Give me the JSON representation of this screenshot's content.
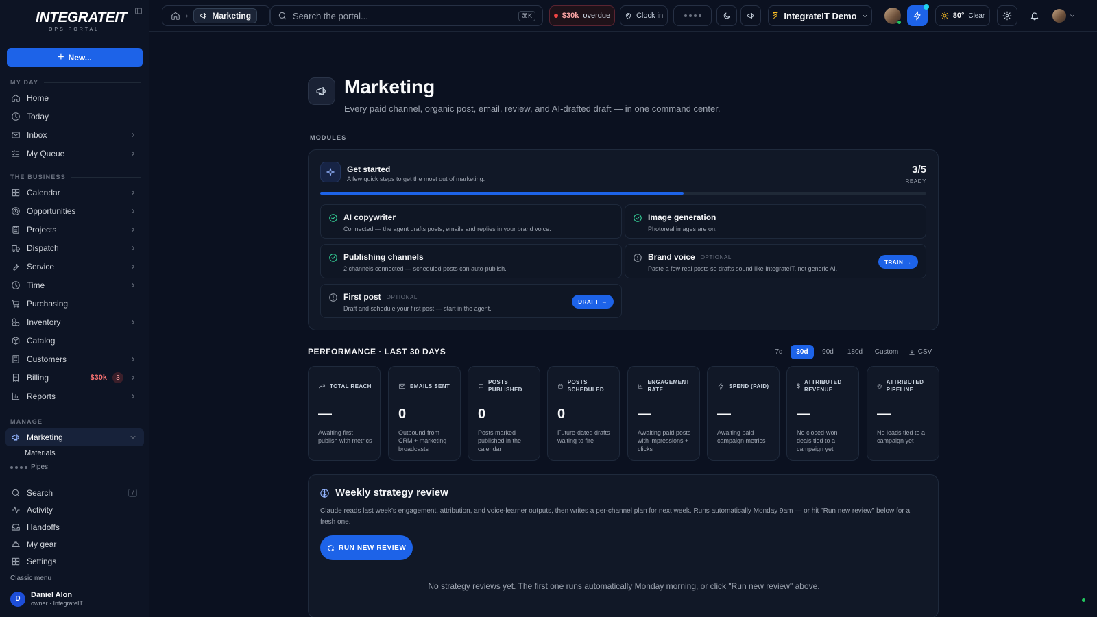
{
  "sidebar": {
    "logo": "INTEGRATEIT",
    "logo_sub": "OPS PORTAL",
    "new_label": "New...",
    "sections": {
      "my_day": "MY DAY",
      "business": "THE BUSINESS",
      "manage": "MANAGE"
    },
    "items": {
      "home": "Home",
      "today": "Today",
      "inbox": "Inbox",
      "queue": "My Queue",
      "calendar": "Calendar",
      "opportunities": "Opportunities",
      "projects": "Projects",
      "dispatch": "Dispatch",
      "service": "Service",
      "time": "Time",
      "purchasing": "Purchasing",
      "inventory": "Inventory",
      "catalog": "Catalog",
      "customers": "Customers",
      "billing": "Billing",
      "reports": "Reports",
      "marketing": "Marketing"
    },
    "billing_amount": "$30k",
    "billing_count": "3",
    "sub_materials": "Materials",
    "pipes": "Pipes",
    "bottom": {
      "search": "Search",
      "search_key": "/",
      "activity": "Activity",
      "handoffs": "Handoffs",
      "gear": "My gear",
      "settings": "Settings"
    },
    "classic_menu": "Classic menu",
    "user": {
      "initial": "D",
      "name": "Daniel Alon",
      "role": "owner · IntegrateIT"
    }
  },
  "topbar": {
    "breadcrumb_current": "Marketing",
    "search_placeholder": "Search the portal...",
    "search_shortcut": "⌘K",
    "overdue_amount": "$30k",
    "overdue_label": "overdue",
    "clock_in": "Clock in",
    "workspace": "IntegrateIT Demo",
    "weather_temp": "80°",
    "weather_cond": "Clear"
  },
  "page": {
    "title": "Marketing",
    "subtitle": "Every paid channel, organic post, email, review, and AI-drafted draft — in one command center.",
    "modules_label": "MODULES"
  },
  "get_started": {
    "title": "Get started",
    "subtitle": "A few quick steps to get the most out of marketing.",
    "count": "3/5",
    "ready": "READY",
    "progress": 0.6,
    "tasks": [
      {
        "title": "AI copywriter",
        "desc": "Connected — the agent drafts posts, emails and replies in your brand voice.",
        "done": true
      },
      {
        "title": "Image generation",
        "desc": "Photoreal images are on.",
        "done": true
      },
      {
        "title": "Publishing channels",
        "desc": "2 channels connected — scheduled posts can auto-publish.",
        "done": true
      },
      {
        "title": "Brand voice",
        "optional": "OPTIONAL",
        "desc": "Paste a few real posts so drafts sound like IntegrateIT, not generic AI.",
        "done": false,
        "action": "TRAIN"
      },
      {
        "title": "First post",
        "optional": "OPTIONAL",
        "desc": "Draft and schedule your first post — start in the agent.",
        "done": false,
        "action": "DRAFT"
      }
    ]
  },
  "performance": {
    "title": "PERFORMANCE · LAST 30 DAYS",
    "ranges": [
      "7d",
      "30d",
      "90d",
      "180d",
      "Custom"
    ],
    "selected_range": "30d",
    "csv": "CSV",
    "metrics": [
      {
        "label": "TOTAL REACH",
        "value": "—",
        "desc": "Awaiting first publish with metrics"
      },
      {
        "label": "EMAILS SENT",
        "value": "0",
        "desc": "Outbound from CRM + marketing broadcasts"
      },
      {
        "label": "POSTS PUBLISHED",
        "value": "0",
        "desc": "Posts marked published in the calendar"
      },
      {
        "label": "POSTS SCHEDULED",
        "value": "0",
        "desc": "Future-dated drafts waiting to fire"
      },
      {
        "label": "ENGAGEMENT RATE",
        "value": "—",
        "desc": "Awaiting paid posts with impressions + clicks"
      },
      {
        "label": "SPEND (PAID)",
        "value": "—",
        "desc": "Awaiting paid campaign metrics"
      },
      {
        "label": "ATTRIBUTED REVENUE",
        "value": "—",
        "desc": "No closed-won deals tied to a campaign yet"
      },
      {
        "label": "ATTRIBUTED PIPELINE",
        "value": "—",
        "desc": "No leads tied to a campaign yet"
      }
    ]
  },
  "weekly": {
    "title": "Weekly strategy review",
    "desc": "Claude reads last week's engagement, attribution, and voice-learner outputs, then writes a per-channel plan for next week. Runs automatically Monday 9am — or hit \"Run new review\" below for a fresh one.",
    "button": "RUN NEW REVIEW",
    "empty": "No strategy reviews yet. The first one runs automatically Monday morning, or click \"Run new review\" above."
  },
  "colors": {
    "accent": "#1d63e8",
    "background": "#0b1120",
    "success": "#34d399",
    "danger": "#ef4444"
  }
}
